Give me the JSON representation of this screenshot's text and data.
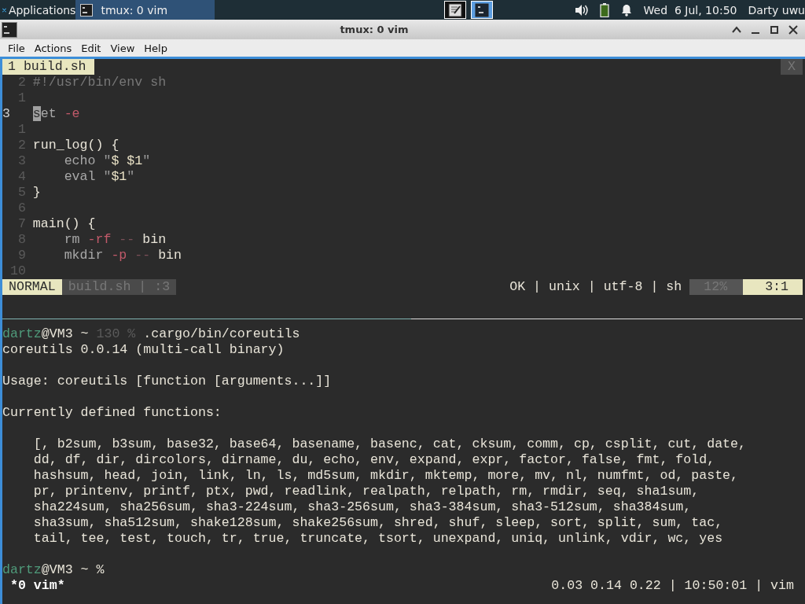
{
  "taskbar": {
    "apps_menu": "Applications",
    "tasks": [
      {
        "label": "tmux: 0 vim",
        "selected": true
      }
    ],
    "workspaces": [
      {
        "kind": "editor",
        "selected": false
      },
      {
        "kind": "terminal",
        "selected": true
      }
    ],
    "clock": "Wed  6 Jul, 10:50",
    "user": "Darty uwu"
  },
  "window": {
    "title": "tmux: 0 vim"
  },
  "menu": [
    "File",
    "Actions",
    "Edit",
    "View",
    "Help"
  ],
  "vim": {
    "tabs": [
      {
        "label": "1 build.sh",
        "selected": true
      }
    ],
    "close_label": "X",
    "lines": [
      {
        "number": "2",
        "current": false,
        "indented": false,
        "tokens": [
          {
            "text": "#!/usr/bin/env sh",
            "kind": "comment"
          }
        ]
      },
      {
        "number": "1",
        "current": false
      },
      {
        "number": "3",
        "current": true,
        "indented": false,
        "tokens": [
          {
            "text": "s",
            "kind": "cursor"
          },
          {
            "text": "et",
            "kind": "builtin"
          },
          {
            "text": " -e",
            "kind": "flag"
          }
        ]
      },
      {
        "number": "1",
        "current": false
      },
      {
        "number": "2",
        "current": false,
        "indented": false,
        "tokens": [
          {
            "text": "run_log() {",
            "kind": "plain"
          }
        ]
      },
      {
        "number": "3",
        "current": false,
        "indented": true,
        "tokens": [
          {
            "text": "echo ",
            "kind": "builtin"
          },
          {
            "text": "\"",
            "kind": "quote"
          },
          {
            "text": "$ $1",
            "kind": "string"
          },
          {
            "text": "\"",
            "kind": "quote"
          }
        ]
      },
      {
        "number": "4",
        "current": false,
        "indented": true,
        "tokens": [
          {
            "text": "eval ",
            "kind": "builtin"
          },
          {
            "text": "\"",
            "kind": "quote"
          },
          {
            "text": "$1",
            "kind": "string"
          },
          {
            "text": "\"",
            "kind": "quote"
          }
        ]
      },
      {
        "number": "5",
        "current": false,
        "indented": false,
        "tokens": [
          {
            "text": "}",
            "kind": "plain"
          }
        ]
      },
      {
        "number": "6",
        "current": false
      },
      {
        "number": "7",
        "current": false,
        "indented": false,
        "tokens": [
          {
            "text": "main() {",
            "kind": "plain"
          }
        ]
      },
      {
        "number": "8",
        "current": false,
        "indented": true,
        "tokens": [
          {
            "text": "rm ",
            "kind": "builtin"
          },
          {
            "text": "-rf",
            "kind": "flag"
          },
          {
            "text": " -- ",
            "kind": "dash"
          },
          {
            "text": "bin",
            "kind": "plain"
          }
        ]
      },
      {
        "number": "9",
        "current": false,
        "indented": true,
        "tokens": [
          {
            "text": "mkdir ",
            "kind": "builtin"
          },
          {
            "text": "-p",
            "kind": "flag"
          },
          {
            "text": " -- ",
            "kind": "dash"
          },
          {
            "text": "bin",
            "kind": "plain"
          }
        ]
      },
      {
        "number": "10",
        "current": false
      }
    ],
    "status": {
      "mode": "NORMAL",
      "file": "build.sh | :3",
      "info": "OK | unix | utf-8 | sh",
      "percent": "12%",
      "position": "3:1"
    }
  },
  "shell": {
    "lines": [
      {
        "kind": "text",
        "tokens": [
          {
            "text": "dartz",
            "kind": "user"
          },
          {
            "text": "@VM3 ~ ",
            "kind": "plain"
          },
          {
            "text": "130 %",
            "kind": "dim"
          },
          {
            "text": " .cargo/bin/coreutils",
            "kind": "plain"
          }
        ]
      },
      {
        "kind": "text",
        "tokens": [
          {
            "text": "coreutils 0.0.14 (multi-call binary)",
            "kind": "plain"
          }
        ]
      },
      {
        "kind": "blank"
      },
      {
        "kind": "text",
        "tokens": [
          {
            "text": "Usage: coreutils [function [arguments...]]",
            "kind": "plain"
          }
        ]
      },
      {
        "kind": "blank"
      },
      {
        "kind": "text",
        "tokens": [
          {
            "text": "Currently defined functions:",
            "kind": "plain"
          }
        ]
      },
      {
        "kind": "blank"
      },
      {
        "kind": "indented",
        "tokens": [
          {
            "text": "[, b2sum, b3sum, base32, base64, basename, basenc, cat, cksum, comm, cp, csplit, cut, date,",
            "kind": "plain"
          }
        ]
      },
      {
        "kind": "indented",
        "tokens": [
          {
            "text": "dd, df, dir, dircolors, dirname, du, echo, env, expand, expr, factor, false, fmt, fold,",
            "kind": "plain"
          }
        ]
      },
      {
        "kind": "indented",
        "tokens": [
          {
            "text": "hashsum, head, join, link, ln, ls, md5sum, mkdir, mktemp, more, mv, nl, numfmt, od, paste,",
            "kind": "plain"
          }
        ]
      },
      {
        "kind": "indented",
        "tokens": [
          {
            "text": "pr, printenv, printf, ptx, pwd, readlink, realpath, relpath, rm, rmdir, seq, sha1sum,",
            "kind": "plain"
          }
        ]
      },
      {
        "kind": "indented",
        "tokens": [
          {
            "text": "sha224sum, sha256sum, sha3-224sum, sha3-256sum, sha3-384sum, sha3-512sum, sha384sum,",
            "kind": "plain"
          }
        ]
      },
      {
        "kind": "indented",
        "tokens": [
          {
            "text": "sha3sum, sha512sum, shake128sum, shake256sum, shred, shuf, sleep, sort, split, sum, tac,",
            "kind": "plain"
          }
        ]
      },
      {
        "kind": "indented",
        "tokens": [
          {
            "text": "tail, tee, test, touch, tr, true, truncate, tsort, unexpand, uniq, unlink, vdir, wc, yes",
            "kind": "plain"
          }
        ]
      },
      {
        "kind": "blank"
      },
      {
        "kind": "text",
        "tokens": [
          {
            "text": "dartz",
            "kind": "user"
          },
          {
            "text": "@VM3 ~ %",
            "kind": "plain"
          }
        ]
      }
    ]
  },
  "tmux_status": {
    "window": "*0 vim*",
    "right": "0.03 0.14 0.22 | 10:50:01 | vim"
  }
}
